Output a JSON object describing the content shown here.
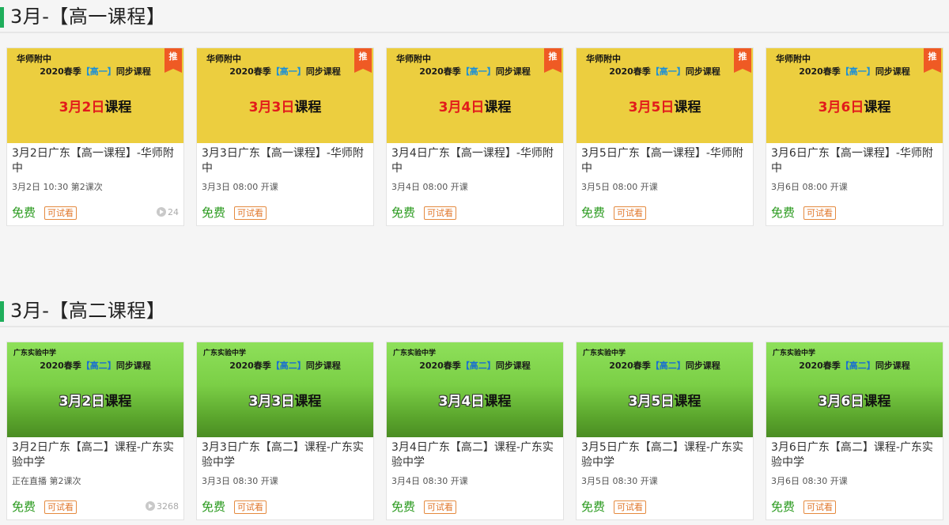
{
  "sections": [
    {
      "title": "3月-【高一课程】",
      "cards": [
        {
          "school": "华师附中",
          "sub_pre": "2020春季",
          "sub_hl": "【高一】",
          "sub_post": "同步课程",
          "big_date": "3月2日",
          "big_rest": "课程",
          "rec": "推",
          "title": "3月2日广东【高一课程】-华师附中",
          "meta": "3月2日 10:30 第2课次",
          "free": "免费",
          "trial": "可试看",
          "views": "24"
        },
        {
          "school": "华师附中",
          "sub_pre": "2020春季",
          "sub_hl": "【高一】",
          "sub_post": "同步课程",
          "big_date": "3月3日",
          "big_rest": "课程",
          "rec": "推",
          "title": "3月3日广东【高一课程】-华师附中",
          "meta": "3月3日 08:00 开课",
          "free": "免费",
          "trial": "可试看",
          "views": ""
        },
        {
          "school": "华师附中",
          "sub_pre": "2020春季",
          "sub_hl": "【高一】",
          "sub_post": "同步课程",
          "big_date": "3月4日",
          "big_rest": "课程",
          "rec": "推",
          "title": "3月4日广东【高一课程】-华师附中",
          "meta": "3月4日 08:00 开课",
          "free": "免费",
          "trial": "可试看",
          "views": ""
        },
        {
          "school": "华师附中",
          "sub_pre": "2020春季",
          "sub_hl": "【高一】",
          "sub_post": "同步课程",
          "big_date": "3月5日",
          "big_rest": "课程",
          "rec": "推",
          "title": "3月5日广东【高一课程】-华师附中",
          "meta": "3月5日 08:00 开课",
          "free": "免费",
          "trial": "可试看",
          "views": ""
        },
        {
          "school": "华师附中",
          "sub_pre": "2020春季",
          "sub_hl": "【高一】",
          "sub_post": "同步课程",
          "big_date": "3月6日",
          "big_rest": "课程",
          "rec": "推",
          "title": "3月6日广东【高一课程】-华师附中",
          "meta": "3月6日 08:00 开课",
          "free": "免费",
          "trial": "可试看",
          "views": ""
        }
      ]
    },
    {
      "title": "3月-【高二课程】",
      "cards": [
        {
          "school": "广东实验中学",
          "sub_pre": "2020春季",
          "sub_hl": "【高二】",
          "sub_post": "同步课程",
          "big_date": "3月2日",
          "big_rest": "课程",
          "rec": "",
          "title": "3月2日广东【高二】课程-广东实验中学",
          "meta": "正在直播 第2课次",
          "free": "免费",
          "trial": "可试看",
          "views": "3268"
        },
        {
          "school": "广东实验中学",
          "sub_pre": "2020春季",
          "sub_hl": "【高二】",
          "sub_post": "同步课程",
          "big_date": "3月3日",
          "big_rest": "课程",
          "rec": "",
          "title": "3月3日广东【高二】课程-广东实验中学",
          "meta": "3月3日 08:30 开课",
          "free": "免费",
          "trial": "可试看",
          "views": ""
        },
        {
          "school": "广东实验中学",
          "sub_pre": "2020春季",
          "sub_hl": "【高二】",
          "sub_post": "同步课程",
          "big_date": "3月4日",
          "big_rest": "课程",
          "rec": "",
          "title": "3月4日广东【高二】课程-广东实验中学",
          "meta": "3月4日 08:30 开课",
          "free": "免费",
          "trial": "可试看",
          "views": ""
        },
        {
          "school": "广东实验中学",
          "sub_pre": "2020春季",
          "sub_hl": "【高二】",
          "sub_post": "同步课程",
          "big_date": "3月5日",
          "big_rest": "课程",
          "rec": "",
          "title": "3月5日广东【高二】课程-广东实验中学",
          "meta": "3月5日 08:30 开课",
          "free": "免费",
          "trial": "可试看",
          "views": ""
        },
        {
          "school": "广东实验中学",
          "sub_pre": "2020春季",
          "sub_hl": "【高二】",
          "sub_post": "同步课程",
          "big_date": "3月6日",
          "big_rest": "课程",
          "rec": "",
          "title": "3月6日广东【高二】课程-广东实验中学",
          "meta": "3月6日 08:30 开课",
          "free": "免费",
          "trial": "可试看",
          "views": ""
        }
      ]
    }
  ],
  "colors": {
    "accent_bar": "#1fae5b",
    "free": "#2a9a1e",
    "trial": "#e0762a",
    "rec_badge": "#ef5a24",
    "thumb_yellow": "#ecce3f",
    "thumb_green": "#7bcf46",
    "date_red": "#e21b1b"
  },
  "icons": {
    "rec": "recommend-badge",
    "views": "play-circle-icon"
  }
}
